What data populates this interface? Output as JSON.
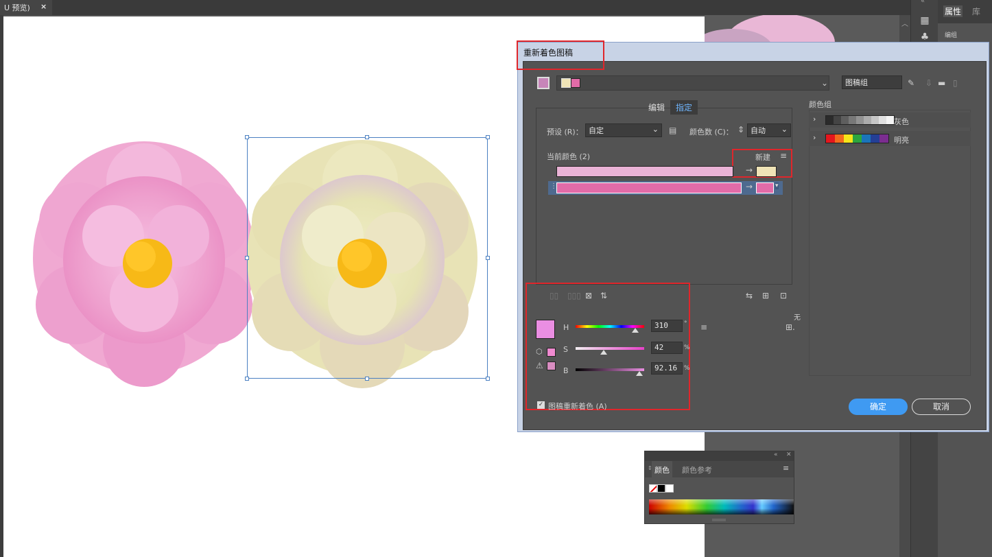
{
  "document_tab": {
    "title": "U 预览)",
    "close": "×"
  },
  "right_panel": {
    "tabs": [
      "属性",
      "库"
    ],
    "sub_label": "编组"
  },
  "dialog": {
    "title": "重新着色图稿",
    "artwork_group_label": "图稿组",
    "tabs": [
      {
        "label": "编辑",
        "active": false
      },
      {
        "label": "指定",
        "active": true
      }
    ],
    "preset_label": "预设 (R)：",
    "preset_value": "自定",
    "color_count_label": "颜色数 (C)：",
    "color_count_value": "自动",
    "current_colors_label": "当前颜色 (2)",
    "new_label": "新建",
    "color_rows": [
      {
        "current": "#eab3d6",
        "new": "#efe3b6"
      },
      {
        "current": "#e26ba8",
        "new": "#e26ba8"
      }
    ],
    "none_label": "无",
    "color_groups_label": "颜色组",
    "color_groups": [
      {
        "name": "灰色",
        "swatches": [
          "#2b2b2b",
          "#444",
          "#5e5e5e",
          "#787878",
          "#929292",
          "#acacac",
          "#c6c6c6",
          "#e0e0e0",
          "#f4f4f4"
        ]
      },
      {
        "name": "明亮",
        "swatches": [
          "#e5161d",
          "#f26b1d",
          "#f5e51a",
          "#2ca53f",
          "#1a74ba",
          "#243f96",
          "#7b2d90"
        ]
      }
    ],
    "hsb": {
      "h": {
        "label": "H",
        "value": "310",
        "unit": "°"
      },
      "s": {
        "label": "S",
        "value": "42",
        "unit": "%"
      },
      "b": {
        "label": "B",
        "value": "92.16",
        "unit": "%"
      },
      "preview_color": "#ea8ee2"
    },
    "recolor_checkbox_label": "图稿重新着色 (A)",
    "recolor_checked": true,
    "ok_label": "确定",
    "cancel_label": "取消"
  },
  "color_panel": {
    "tabs": [
      {
        "label": "颜色",
        "active": true
      },
      {
        "label": "颜色参考",
        "active": false
      }
    ]
  },
  "colors": {
    "accent_blue": "#3f9af2",
    "highlight_red": "#e0262b",
    "pink_flower": "#ee9fcd",
    "yellow_flower": "#e6e3b4",
    "flower_center": "#f7b917"
  }
}
